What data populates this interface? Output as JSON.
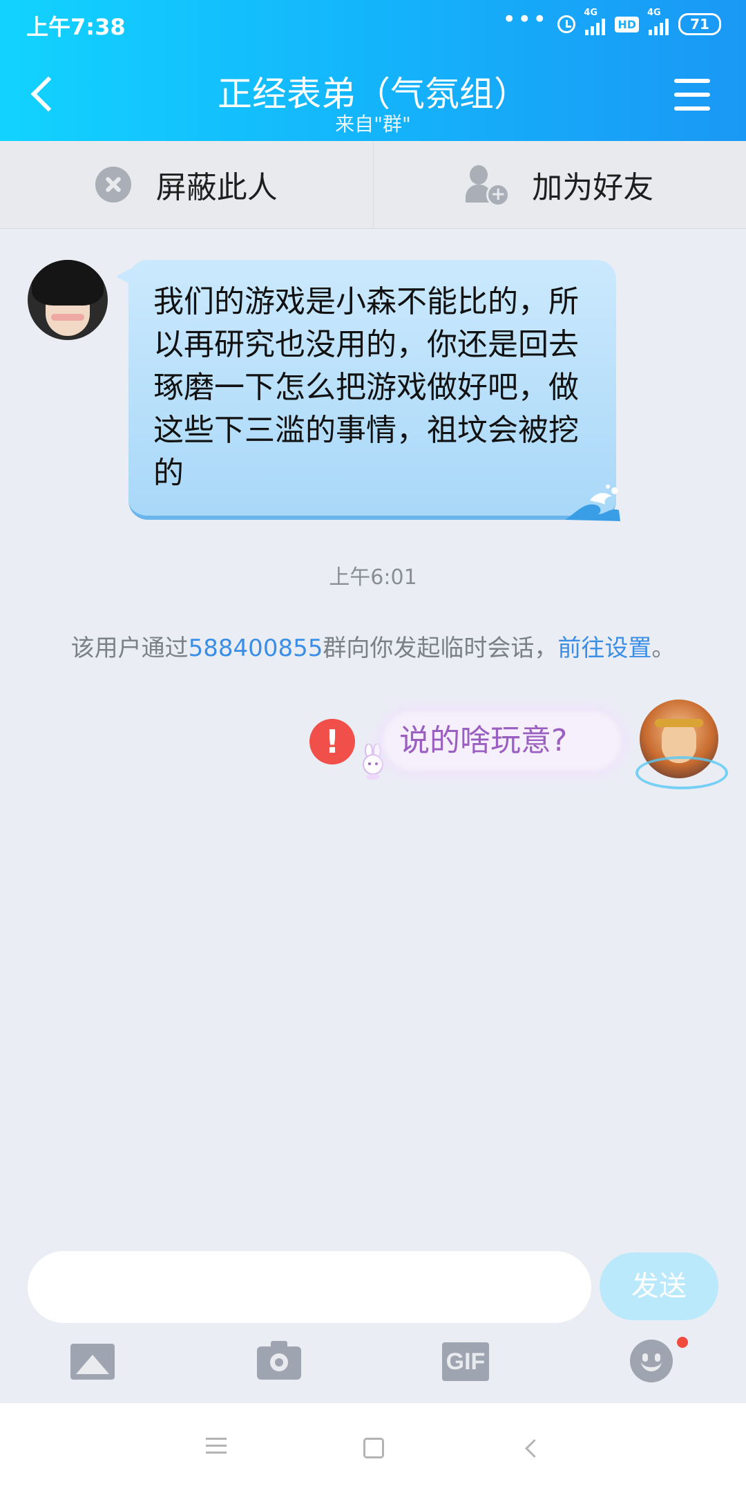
{
  "status_bar": {
    "time": "上午7:38",
    "network_1": "4G",
    "hd": "HD",
    "network_2": "4G",
    "battery": "71"
  },
  "header": {
    "title": "正经表弟（气氛组）",
    "subtitle": "来自\"群\""
  },
  "actions": {
    "block_label": "屏蔽此人",
    "add_friend_label": "加为好友"
  },
  "messages": {
    "incoming_text": "我们的游戏是小森不能比的，所以再研究也没用的，你还是回去琢磨一下怎么把游戏做好吧，做这些下三滥的事情，祖坟会被挖的",
    "timestamp": "上午6:01",
    "notice": {
      "prefix": "该用户通过",
      "group_id": "588400855",
      "middle": "群向你发起临时会话，",
      "link": "前往设置",
      "suffix": "。"
    },
    "outgoing_text": "说的啥玩意?"
  },
  "input": {
    "value": "",
    "placeholder": "",
    "send_label": "发送"
  },
  "toolbar": {
    "gif_label": "GIF"
  }
}
